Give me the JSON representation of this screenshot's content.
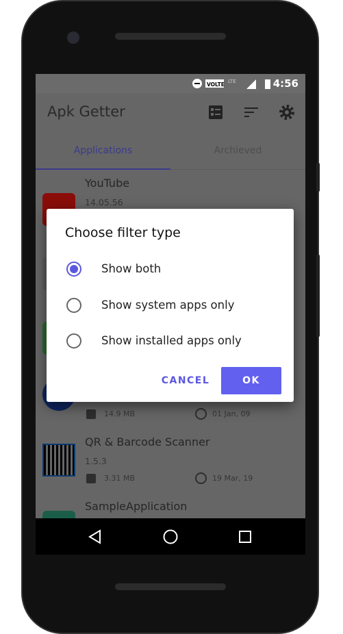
{
  "status_bar": {
    "time": "4:56",
    "volte": "VOLTE",
    "network": "LTE"
  },
  "app_bar": {
    "title": "Apk Getter",
    "icons": [
      "checklist-icon",
      "sort-icon",
      "settings-gear-icon"
    ]
  },
  "tabs": [
    {
      "label": "Applications",
      "active": true
    },
    {
      "label": "Archieved",
      "active": false
    }
  ],
  "apps": [
    {
      "name": "YouTube",
      "version": "14.05.56",
      "size": "",
      "date": "",
      "icon": "youtube-icon"
    },
    {
      "name": "",
      "version": "",
      "size": "",
      "date": "",
      "icon": "app-icon"
    },
    {
      "name": "",
      "version": "",
      "size": "",
      "date": "",
      "icon": "app-icon"
    },
    {
      "name": "",
      "version": "",
      "size": "14.9 MB",
      "date": "01 Jan, 09",
      "icon": "app-icon"
    },
    {
      "name": "QR & Barcode Scanner",
      "version": "1.5.3",
      "size": "3.31 MB",
      "date": "19 Mar, 19",
      "icon": "qr-code-icon"
    },
    {
      "name": "SampleApplication",
      "version": "",
      "size": "",
      "date": "",
      "icon": "app-icon"
    }
  ],
  "dialog": {
    "title": "Choose filter type",
    "options": [
      {
        "label": "Show both",
        "selected": true
      },
      {
        "label": "Show system apps only",
        "selected": false
      },
      {
        "label": "Show installed apps only",
        "selected": false
      }
    ],
    "cancel": "CANCEL",
    "ok": "OK"
  },
  "colors": {
    "accent": "#5b57e0",
    "ok_button": "#6260ef"
  }
}
